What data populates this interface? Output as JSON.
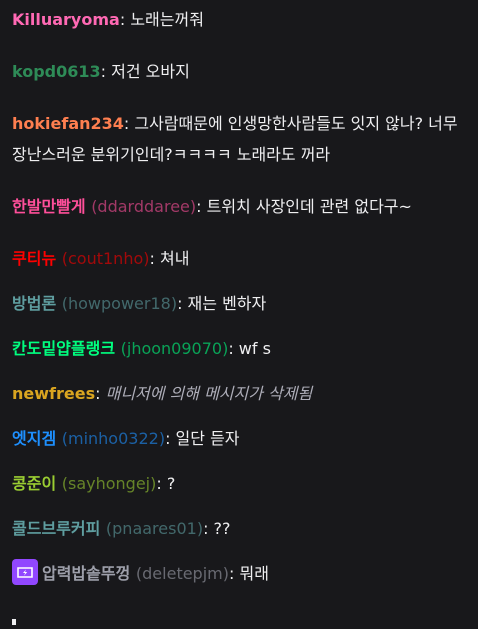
{
  "messages": [
    {
      "name": "Killuaryoma",
      "login": "",
      "color": "#ff69b4",
      "text": "노래는꺼줘",
      "deleted": false
    },
    {
      "name": "kopd0613",
      "login": "",
      "color": "#2e8b57",
      "text": "저건 오바지",
      "deleted": false
    },
    {
      "name": "hokiefan234",
      "login": "",
      "color": "#ff7f50",
      "text": "그사람때문에 인생망한사람들도 잇지 않나? 너무 장난스러운 분위기인데?ㅋㅋㅋㅋ 노래라도 꺼라",
      "deleted": false
    },
    {
      "name": "한발만빨게",
      "login": "(ddarddaree)",
      "color": "#ff4f9a",
      "text": "트위치 사장인데 관련 없다구~",
      "deleted": false
    },
    {
      "name": "쿠티뉴",
      "login": "(cout1nho)",
      "color": "#ff0000",
      "text": "쳐내",
      "deleted": false
    },
    {
      "name": "방법론",
      "login": "(howpower18)",
      "color": "#5f9ea0",
      "text": "재는 벤하자",
      "deleted": false
    },
    {
      "name": "칸도밑얍플랭크",
      "login": "(jhoon09070)",
      "color": "#00ff7f",
      "text": "wf s",
      "deleted": false
    },
    {
      "name": "newfrees",
      "login": "",
      "color": "#daa520",
      "text": "매니저에 의해 메시지가 삭제됨",
      "deleted": true
    },
    {
      "name": "엣지겜",
      "login": "(minho0322)",
      "color": "#1e90ff",
      "text": "일단 듣자",
      "deleted": false
    },
    {
      "name": "콩준이",
      "login": "(sayhongej)",
      "color": "#9acd32",
      "text": "?",
      "deleted": false
    },
    {
      "name": "콜드브루커피",
      "login": "(pnaares01)",
      "color": "#5f9ea0",
      "text": "??",
      "deleted": false
    },
    {
      "name": "압력밥솥뚜껑",
      "login": "(deletepjm)",
      "color": "#9ea0ab",
      "text": "뭐래",
      "deleted": false,
      "badge": "prime-badge-icon"
    }
  ],
  "colors": {
    "background": "#18181b",
    "text": "#efeff1",
    "badge": "#9147ff"
  }
}
